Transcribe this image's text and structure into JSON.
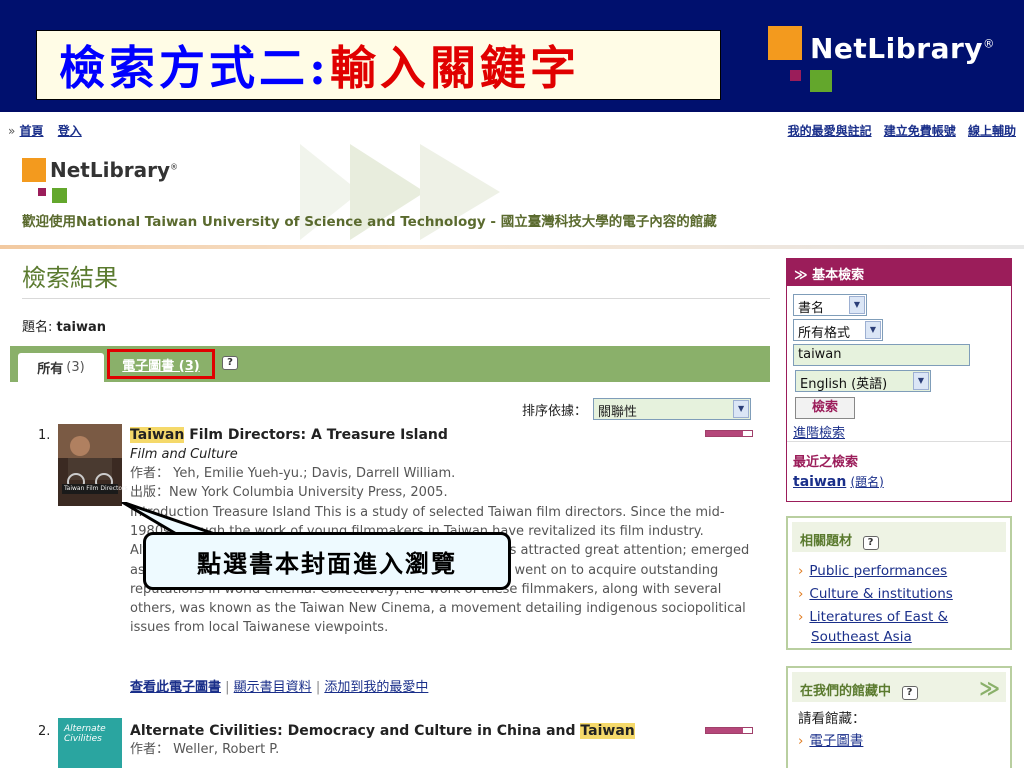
{
  "slide": {
    "title_part1": "檢索方式二:",
    "title_part2": "輸入關鍵字",
    "logo_text": "NetLibrary",
    "logo_reg": "®"
  },
  "nav": {
    "home": "首頁",
    "login": "登入",
    "right_links": [
      "我的最愛與註記",
      "建立免費帳號",
      "線上輔助"
    ]
  },
  "banner": {
    "logo_text": "NetLibrary",
    "logo_reg": "®",
    "welcome": "歡迎使用National Taiwan University of Science and Technology - 國立臺灣科技大學的電子內容的館藏"
  },
  "results": {
    "heading": "檢索結果",
    "query_label": "題名:",
    "query_value": "taiwan",
    "tabs": {
      "all_label": "所有",
      "all_count": "(3)",
      "ebook_label": "電子圖書 (3)"
    },
    "help_icon": "?",
    "sort_label": "排序依據：",
    "sort_value": "關聯性",
    "items": [
      {
        "num": "1.",
        "title_highlight": "Taiwan",
        "title_rest": " Film Directors: A Treasure Island",
        "subtitle": "Film and Culture",
        "author_label": "作者：",
        "author": "Yeh, Emilie Yueh-yu.; Davis, Darrell William.",
        "publisher_label": "出版：",
        "publisher": "New York Columbia University Press, 2005.",
        "description": "Introduction Treasure Island This is a study of selected Taiwan film directors. Since the mid-1980s through the work of young filmmakers in Taiwan have revitalized its film industry. Although it was not the intent of these directors, their films attracted great attention; emerged as a pivotal, controversial feature of Taiwan directors, who went on to acquire outstanding reputations in world cinema. Collectively, the work of these filmmakers, along with several others, was known as the Taiwan New Cinema, a movement detailing indigenous sociopolitical issues from local Taiwanese viewpoints.",
        "links": [
          "查看此電子圖書",
          "顯示書目資料",
          "添加到我的最愛中"
        ],
        "relevance": 0.8
      },
      {
        "num": "2.",
        "title_pre": "Alternate Civilities: Democracy and Culture in China and ",
        "title_highlight": "Taiwan",
        "author_label": "作者：",
        "author": "Weller, Robert P.",
        "cover_text": "Alternate Civilities",
        "relevance": 0.8
      }
    ],
    "cover1_text": "Taiwan Film Directors"
  },
  "callout": {
    "text": "點選書本封面進入瀏覽"
  },
  "sidebar": {
    "basic_search_title": "基本檢索",
    "field_select": "書名",
    "format_select": "所有格式",
    "search_input": "taiwan",
    "language_select": "English (英語)",
    "search_button": "檢索",
    "advanced_link": "進階檢索",
    "recent_title": "最近之檢索",
    "recent_term": "taiwan",
    "recent_field": "(題名)",
    "related_title": "相關題材",
    "related_topics": [
      "Public performances",
      "Culture & institutions",
      "Literatures of East &",
      "Southeast Asia"
    ],
    "collection_title": "在我們的館藏中",
    "collection_label": "請看館藏：",
    "collection_link": "電子圖書"
  },
  "colors": {
    "slide_bg": "#00106e",
    "accent_magenta": "#9b1d5a",
    "tab_green": "#8ab06a",
    "highlight": "#f5d96a",
    "callout_border": "#e00000"
  }
}
